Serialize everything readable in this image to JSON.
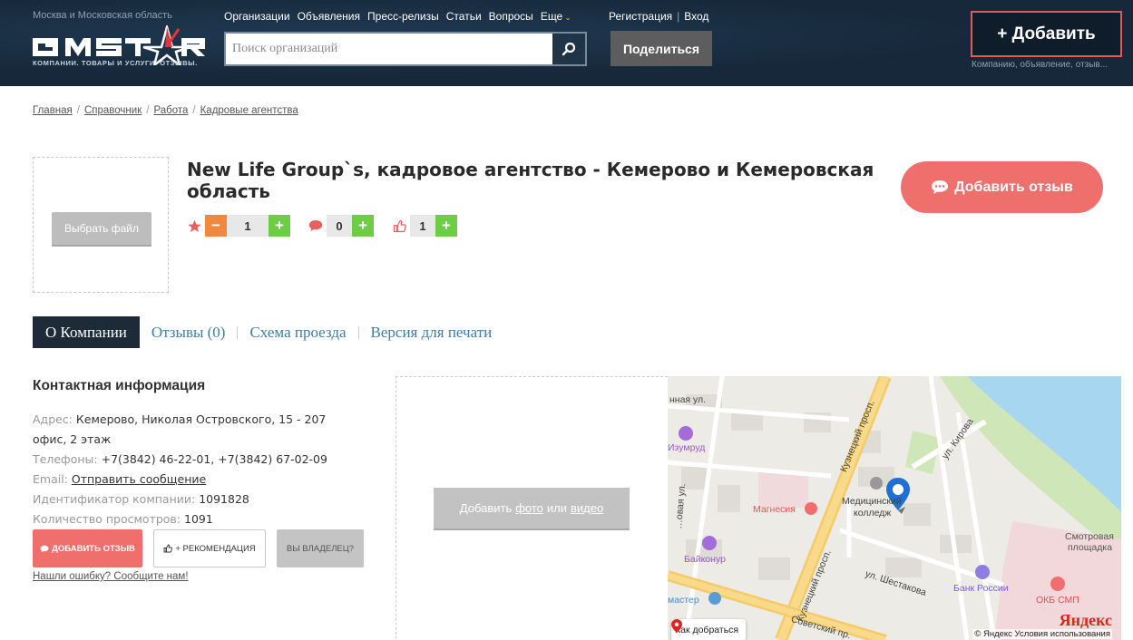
{
  "header": {
    "region": "Москва и Московская область",
    "logo_text": "GMSTAR",
    "tagline": "КОМПАНИИ. ТОВАРЫ И УСЛУГИ. ОТЗЫВЫ.",
    "nav": [
      "Организации",
      "Объявления",
      "Пресс-релизы",
      "Статьи",
      "Вопросы",
      "Еще"
    ],
    "search_placeholder": "Поиск организаций",
    "register": "Регистрация",
    "login": "Вход",
    "share": "Поделиться",
    "add_button": "+ Добавить",
    "add_hint": "Компанию, объявление, отзыв..."
  },
  "breadcrumb": [
    "Главная",
    "Справочник",
    "Работа",
    "Кадровые агентства"
  ],
  "company": {
    "choose_file": "Выбрать файл",
    "title": "New Life Group`s, кадровое агентство - Кемерово и Кемеровская область",
    "add_review": "Добавить отзыв",
    "rating": "1",
    "reviews_count": "0",
    "likes": "1"
  },
  "tabs": [
    "О Компании",
    "Отзывы (0)",
    "Схема проезда",
    "Версия для печати"
  ],
  "contacts": {
    "title": "Контактная информация",
    "address_label": "Адрес:",
    "address": "Кемерово, Николая Островского, 15 - 207 офис, 2 этаж",
    "phones_label": "Телефоны:",
    "phones": "+7(3842) 46-22-01, +7(3842) 67-02-09",
    "email_label": "Email:",
    "email_link": "Отправить сообщение",
    "id_label": "Идентификатор компании:",
    "id": "1091828",
    "views_label": "Количество просмотров:",
    "views": "1091",
    "btn_review": "ДОБАВИТЬ ОТЗЫВ",
    "btn_recommend": "+ РЕКОМЕНДАЦИЯ",
    "btn_owner": "ВЫ ВЛАДЕЛЕЦ?",
    "report": "Нашли ошибку? Сообщите нам!"
  },
  "media": {
    "prefix": "Добавить",
    "photo": "фото",
    "or": "или",
    "video": "видео"
  },
  "map": {
    "labels": {
      "street1": "нная ул.",
      "izumrud": "Изумруд",
      "magnesia": "Магнесия",
      "med1": "Медицинский",
      "med2": "колледж",
      "kirova": "ул. Кирова",
      "kuzn_top": "Кузнецкий просп.",
      "kuzn_bottom": "Кузнецкий просп.",
      "baikonur": "Байконур",
      "shestakova": "ул. Шестакова",
      "bank": "Банк России",
      "okb": "ОКБ СМП",
      "smotr1": "Смотровая",
      "smotr2": "площадка",
      "master": "мастер",
      "sovet": "Советский пр.",
      "left_street": "…овая ул."
    },
    "route": "Как добраться",
    "yandex": "Яндекс",
    "legal": "© Яндекс  Условия использования"
  },
  "colors": {
    "header_bg": "#16283a",
    "accent_red": "#ef6f6c",
    "plus_green": "#6fcc45",
    "minus_orange": "#f0883e",
    "tab_active": "#1d2b38",
    "link_blue": "#3d7ea6"
  }
}
